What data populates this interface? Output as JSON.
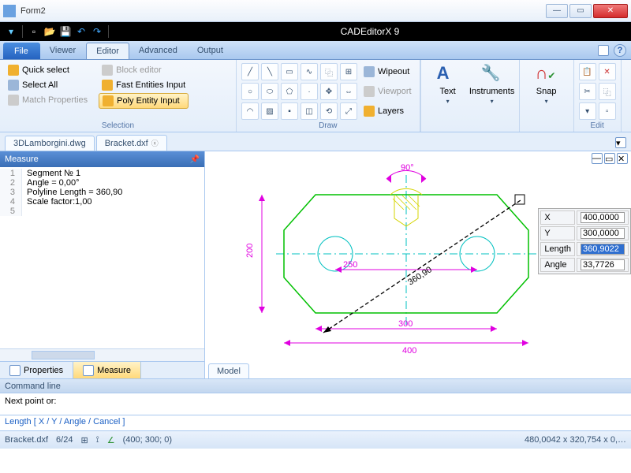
{
  "window": {
    "title": "Form2"
  },
  "app_title": "CADEditorX 9",
  "menu": {
    "file": "File",
    "viewer": "Viewer",
    "editor": "Editor",
    "advanced": "Advanced",
    "output": "Output"
  },
  "ribbon": {
    "selection": {
      "quick_select": "Quick select",
      "select_all": "Select All",
      "match_properties": "Match Properties",
      "block_editor": "Block editor",
      "fast_entities": "Fast Entities Input",
      "poly_entity": "Poly Entity Input",
      "label": "Selection"
    },
    "draw": {
      "wipeout": "Wipeout",
      "viewport": "Viewport",
      "layers": "Layers",
      "label": "Draw"
    },
    "panel": {
      "text": "Text",
      "instruments": "Instruments",
      "snap": "Snap",
      "edit_label": "Edit"
    }
  },
  "tabs": {
    "a": "3DLamborgini.dwg",
    "b": "Bracket.dxf",
    "model": "Model"
  },
  "left": {
    "header": "Measure",
    "lines": [
      "Segment № 1",
      "Angle = 0,00°",
      "Polyline Length = 360,90",
      "Scale factor:1,00",
      ""
    ],
    "tab_props": "Properties",
    "tab_measure": "Measure"
  },
  "coords_panel": {
    "x_label": "X",
    "x_val": "400,0000",
    "y_label": "Y",
    "y_val": "300,0000",
    "len_label": "Length",
    "len_val": "360,9022",
    "ang_label": "Angle",
    "ang_val": "33,7726"
  },
  "drawing": {
    "angle_label": "90°",
    "dim_200": "200",
    "dim_250": "250",
    "dim_300": "300",
    "dim_400": "400",
    "meas": "360,90"
  },
  "cmd": {
    "header": "Command line",
    "prompt": "Next point or:",
    "opts": "Length  [  X  /  Y  /  Angle  /  Cancel  ]"
  },
  "status": {
    "file": "Bracket.dxf",
    "ratio": "6/24",
    "coords": "(400; 300; 0)",
    "dims": "480,0042 x 320,754 x 0,…"
  }
}
